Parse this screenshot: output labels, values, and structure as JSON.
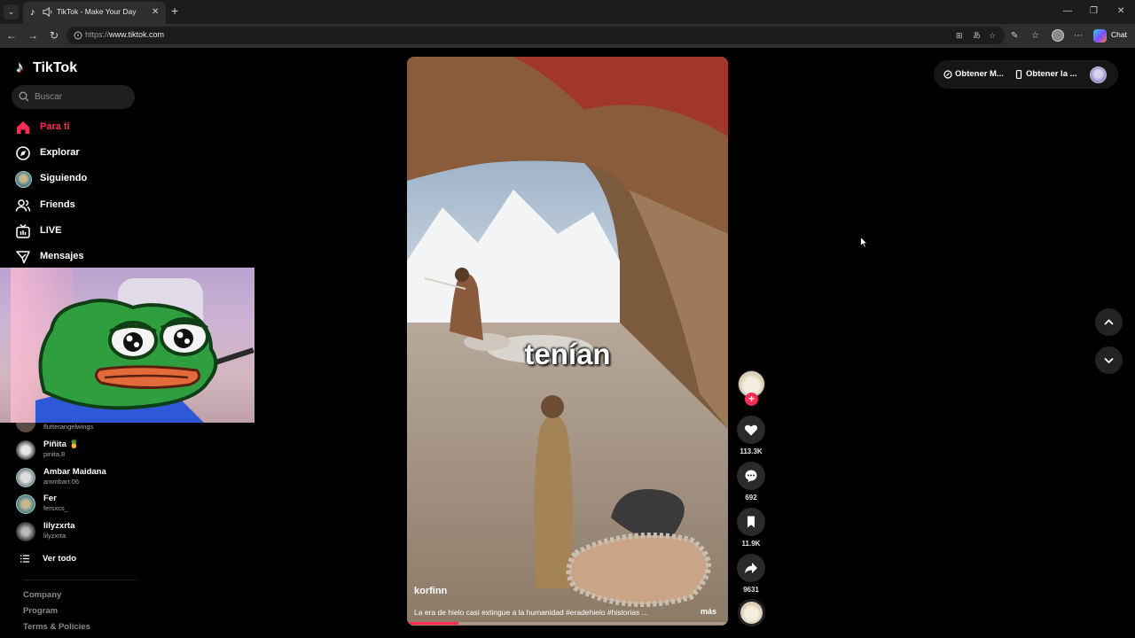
{
  "browser": {
    "tab_title": "TikTok - Make Your Day",
    "tab_close": "✕",
    "new_tab": "+",
    "url_scheme": "https://",
    "url_host": "www.tiktok.com",
    "chat_label": "Chat",
    "window_controls": [
      "—",
      "❐",
      "✕"
    ]
  },
  "sidebar": {
    "logo_text": "TikTok",
    "search_placeholder": "Buscar",
    "nav": [
      {
        "label": "Para ti",
        "icon": "home-icon",
        "active": true
      },
      {
        "label": "Explorar",
        "icon": "compass-icon"
      },
      {
        "label": "Siguiendo",
        "icon": "following-avatar"
      },
      {
        "label": "Friends",
        "icon": "friends-icon"
      },
      {
        "label": "LIVE",
        "icon": "live-icon"
      },
      {
        "label": "Mensajes",
        "icon": "messages-icon"
      }
    ],
    "following_accounts": [
      {
        "name": "",
        "handle": "flutterangelwings"
      },
      {
        "name": "Piñita 🍍",
        "handle": "pinita.8"
      },
      {
        "name": "Ambar Maidana",
        "handle": "ammbarr.06"
      },
      {
        "name": "Fer",
        "handle": "fersxcs_"
      },
      {
        "name": "lilyzxrta",
        "handle": "lilyzxrta"
      }
    ],
    "see_all": "Ver todo",
    "footer_links": [
      "Company",
      "Program",
      "Terms & Policies"
    ]
  },
  "video": {
    "caption_overlay": "tenían",
    "author": "korfinn",
    "description": "La era de hielo casi extingue a la humanidad #eradehielo #historias ...",
    "more_label": "más",
    "progress_fraction": 0.16
  },
  "actions": {
    "follow_plus": "+",
    "likes": "113.3K",
    "comments": "692",
    "saves": "11.9K",
    "shares": "9631"
  },
  "top_actions": {
    "get_app": "Obtener M...",
    "get_desktop": "Obtener la ..."
  },
  "colors": {
    "accent": "#fe2c55",
    "background": "#000000"
  }
}
